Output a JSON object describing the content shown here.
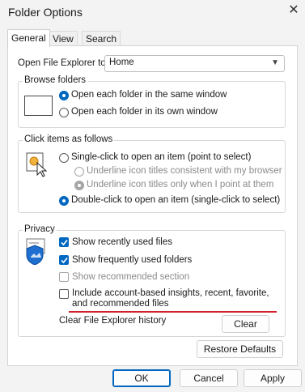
{
  "window": {
    "title": "Folder Options",
    "close_glyph": "✕"
  },
  "tabs": [
    {
      "label": "General",
      "active": true
    },
    {
      "label": "View",
      "active": false
    },
    {
      "label": "Search",
      "active": false
    }
  ],
  "open_explorer": {
    "label": "Open File Explorer to:",
    "value": "Home"
  },
  "browse_folders": {
    "title": "Browse folders",
    "options": [
      {
        "label": "Open each folder in the same window",
        "selected": true
      },
      {
        "label": "Open each folder in its own window",
        "selected": false
      }
    ]
  },
  "click_items": {
    "title": "Click items as follows",
    "single": {
      "label": "Single-click to open an item (point to select)",
      "selected": false
    },
    "underline_browser": {
      "label": "Underline icon titles consistent with my browser",
      "selected": false,
      "disabled": true
    },
    "underline_point": {
      "label": "Underline icon titles only when I point at them",
      "selected": true,
      "disabled": true
    },
    "double": {
      "label": "Double-click to open an item (single-click to select)",
      "selected": true
    }
  },
  "privacy": {
    "title": "Privacy",
    "recent_files": {
      "label": "Show recently used files",
      "checked": true
    },
    "frequent_folders": {
      "label": "Show frequently used folders",
      "checked": true
    },
    "recommended": {
      "label": "Show recommended section",
      "checked": false,
      "disabled": true
    },
    "insights": {
      "label": "Include account-based insights, recent, favorite, and recommended files",
      "checked": false
    },
    "clear_history_label": "Clear File Explorer history",
    "clear_button": "Clear"
  },
  "restore_defaults": "Restore Defaults",
  "footer": {
    "ok": "OK",
    "cancel": "Cancel",
    "apply": "Apply"
  },
  "colors": {
    "accent": "#0067c0",
    "highlight_line": "#d0202e"
  },
  "icons": [
    "close-icon",
    "chevron-down-icon",
    "folder-window-icon",
    "click-pointer-icon",
    "privacy-shield-icon",
    "checkmark-icon"
  ]
}
